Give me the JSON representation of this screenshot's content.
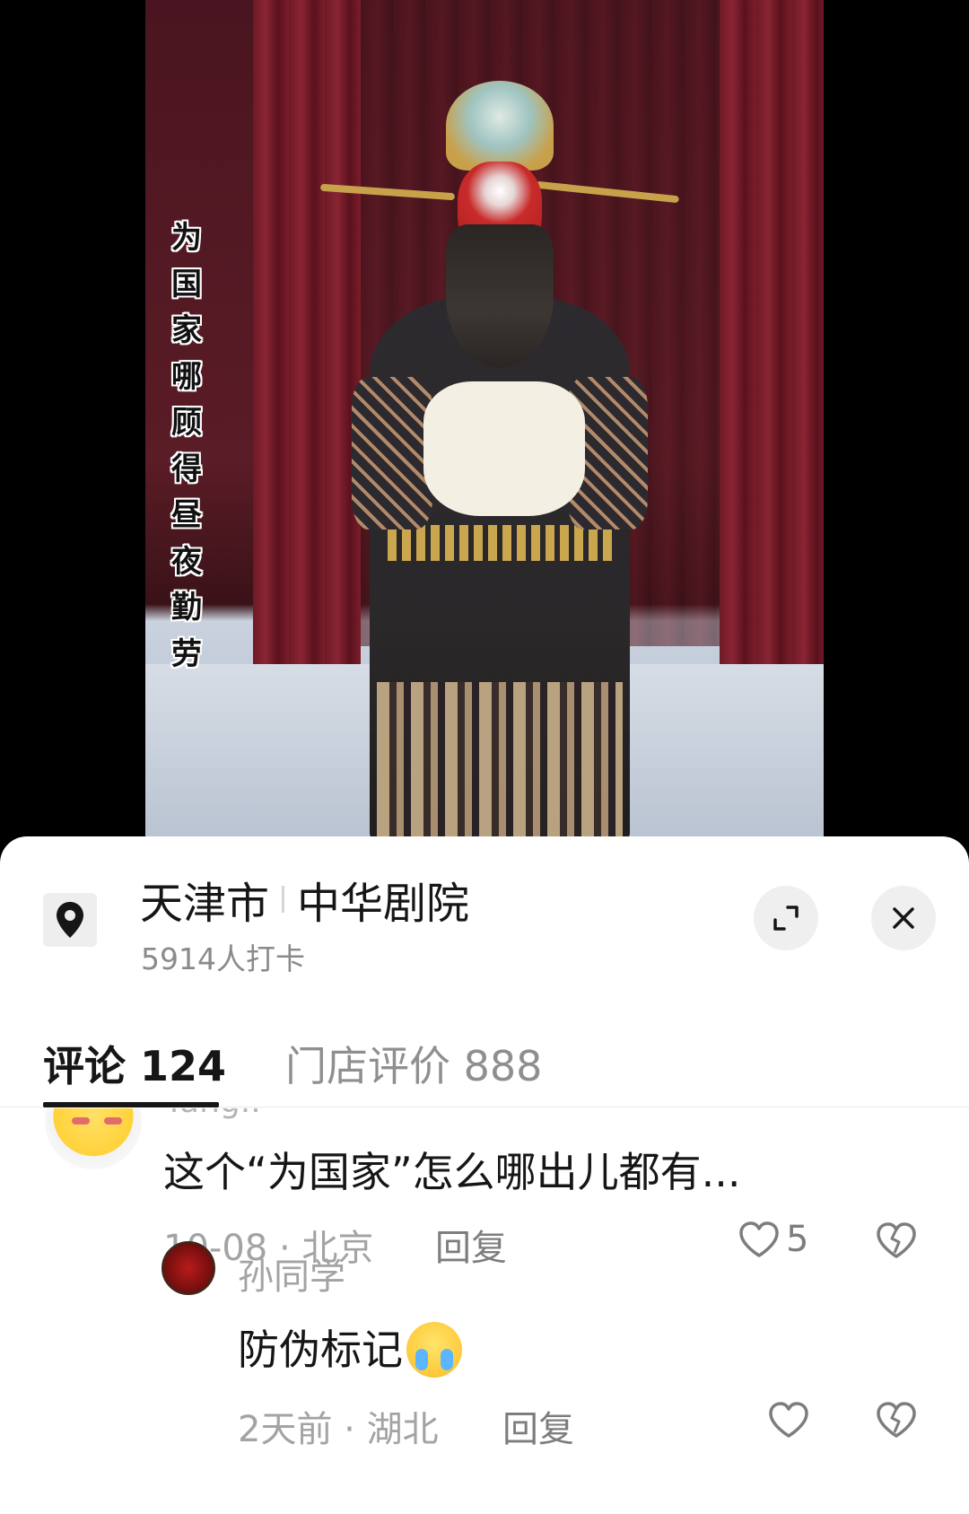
{
  "video": {
    "subtitle_chars": [
      "为",
      "国",
      "家",
      "哪",
      "顾",
      "得",
      "昼",
      "夜",
      "勤",
      "劳"
    ]
  },
  "location": {
    "city": "天津市",
    "venue": "中华剧院",
    "checkins": "5914人打卡",
    "icon": "location-pin-icon"
  },
  "tabs": [
    {
      "label": "评论 124",
      "active": true
    },
    {
      "label": "门店评价 888",
      "active": false
    }
  ],
  "comments": [
    {
      "username_partial": "Yang..",
      "text": "这个“为国家”怎么哪出儿都有...",
      "meta": "10-08 · 北京",
      "reply_label": "回复",
      "likes": "5"
    },
    {
      "username": "孙同学",
      "text": "防伪标记",
      "emoji": "crying-face",
      "meta": "2天前 · 湖北",
      "reply_label": "回复"
    }
  ],
  "colors": {
    "primary_text": "#161616",
    "secondary_text": "#8a8a8a",
    "sheet_bg": "#ffffff",
    "button_bg": "#efefef"
  }
}
